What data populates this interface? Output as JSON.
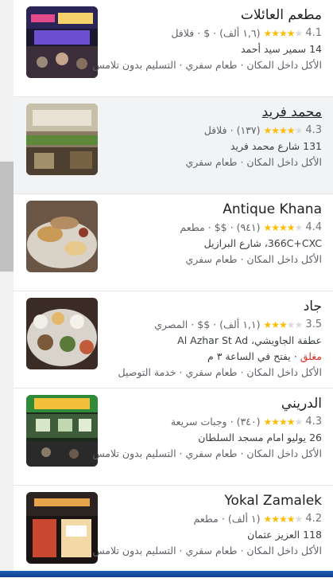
{
  "places": [
    {
      "name": "مطعم العائلات",
      "rating": "4.1",
      "rating_value": 4.1,
      "reviews": "(١,٦ ألف)",
      "price": "$",
      "category": "فلافل",
      "address": "14 سمير سيد أحمد",
      "services": "الأكل داخل المكان · طعام سفري · التسليم بدون تلامس"
    },
    {
      "name": "محمد فريد",
      "rating": "4.3",
      "rating_value": 4.3,
      "reviews": "(١٣٧)",
      "price": "",
      "category": "فلافل",
      "address": "131 شارع محمد فريد",
      "services": "الأكل داخل المكان · طعام سفري"
    },
    {
      "name": "Antique Khana",
      "rating": "4.4",
      "rating_value": 4.4,
      "reviews": "(٩٤١)",
      "price": "$$",
      "category": "مطعم",
      "address": "366C+CXC، شارع البرازيل",
      "services": "الأكل داخل المكان · طعام سفري"
    },
    {
      "name": "جاد",
      "rating": "3.5",
      "rating_value": 3.5,
      "reviews": "(١,١ ألف)",
      "price": "$$",
      "category": "المصري",
      "address": "عطفة الجاويشي، Al Azhar St Ad",
      "status_closed": "مغلق",
      "status_opens": " · يفتح في الساعة ٣ م",
      "services": "الأكل داخل المكان · طعام سفري · خدمة التوصيل"
    },
    {
      "name": "الدريني",
      "rating": "4.3",
      "rating_value": 4.3,
      "reviews": "(٣٤٠)",
      "price": "",
      "category": "وجبات سريعة",
      "address": "26 يوليو امام مسجد السلطان",
      "services": "الأكل داخل المكان · طعام سفري · التسليم بدون تلامس"
    },
    {
      "name": "Yokal Zamalek",
      "rating": "4.2",
      "rating_value": 4.2,
      "reviews": "(١ ألف)",
      "price": "",
      "category": "مطعم",
      "address": "118 العزيز عثمان",
      "services": "الأكل داخل المكان · طعام سفري · التسليم بدون تلامس"
    }
  ],
  "colors": {
    "star": "#fbbc04",
    "closed": "#d93025",
    "selected_bg": "#f1f3f4"
  }
}
